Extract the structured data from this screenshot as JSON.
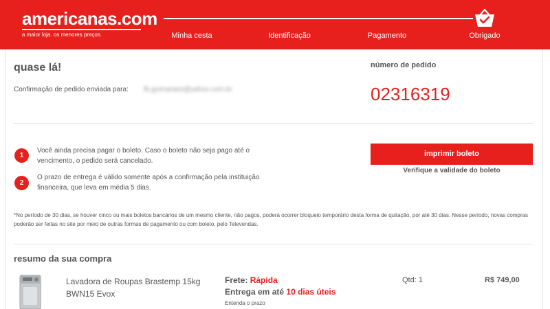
{
  "header": {
    "brand": "americanas.com",
    "tagline": "a maior loja. os menores preços.",
    "steps": [
      "Minha cesta",
      "Identificação",
      "Pagamento",
      "Obrigado"
    ],
    "current_step_icon": "basket-check-icon"
  },
  "order": {
    "greeting": "quase lá!",
    "confirm_label": "Confirmação de pedido enviada para:",
    "email": "fb.guimaraes@yahoo.com.br",
    "number_label": "número de pedido",
    "number": "02316319"
  },
  "notes": [
    {
      "index": "1",
      "text": "Você ainda precisa pagar o boleto. Caso o boleto não seja pago até o vencimento, o pedido será cancelado."
    },
    {
      "index": "2",
      "text": "O prazo de entrega é válido somente após a confirmação pela instituição financeira, que leva em média 5 dias."
    }
  ],
  "actions": {
    "print_label": "imprimir boleto",
    "verify_label": "Verifique a validade do boleto"
  },
  "disclaimer": "*No período de 30 dias, se houver cinco ou mais boletos bancários de um mesmo cliente, não pagos, poderá ocorrer bloqueio temporário desta forma de quitação, por até 30 dias. Nesse período, novas compras poderão ser feitas no site por meio de outras formas de pagamento ou com boleto, pelo Televendas.",
  "summary": {
    "title": "resumo da sua compra",
    "item": {
      "name": "Lavadora de Roupas Brastemp 15kg BWN15 Evox",
      "frete_label": "Frete:",
      "frete_value": "Rápida",
      "entrega_label": "Entrega em até",
      "entrega_value": "10 dias úteis",
      "entenda_label": "Entenda o prazo",
      "qty": "Qtd: 1",
      "price": "R$ 749,00"
    }
  },
  "colors": {
    "brand_red": "#e8201d",
    "text_gray": "#555555",
    "divider": "#e2e2e2"
  }
}
